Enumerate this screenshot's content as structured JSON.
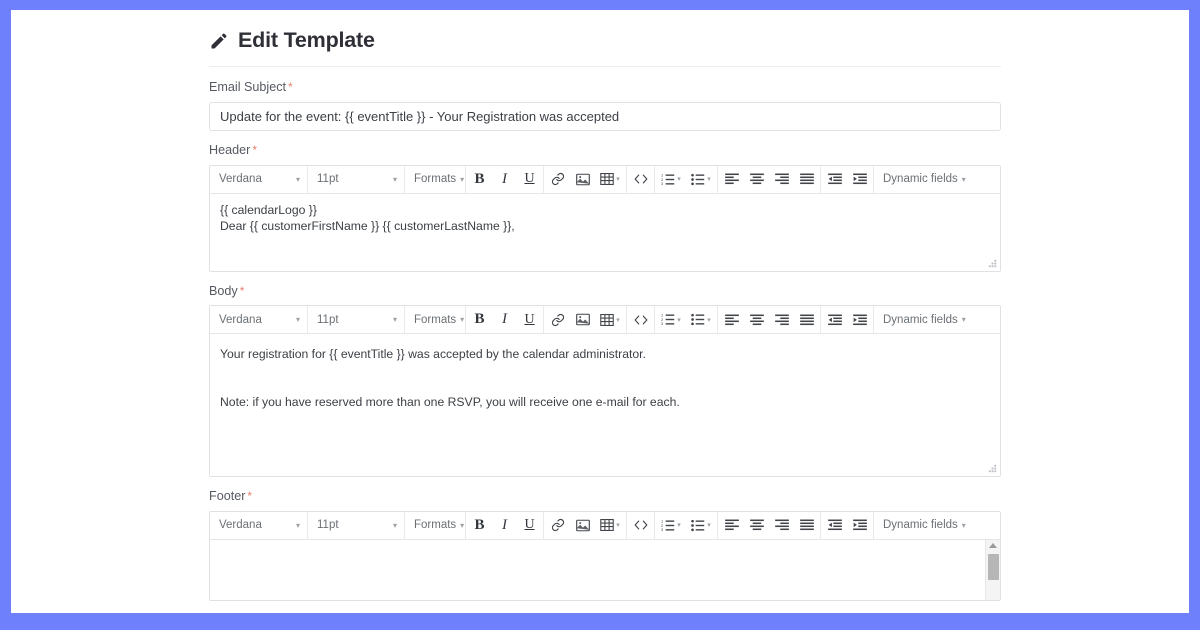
{
  "theme": {
    "frame_color": "#6e80fb",
    "page_background": "#ffffff",
    "required_marker_color": "#e8806f",
    "title_color": "#2f3037",
    "label_color": "#555a61",
    "border_color": "#dfe1e5"
  },
  "header": {
    "title": "Edit Template",
    "icon": "pencil-icon"
  },
  "fields": {
    "subject": {
      "label": "Email Subject",
      "required_marker": "*",
      "value": "Update for the event: {{ eventTitle }} - Your Registration was accepted",
      "placeholder": ""
    },
    "header_section": {
      "label": "Header",
      "required_marker": "*",
      "lines": [
        "{{ calendarLogo }}",
        "Dear {{ customerFirstName }} {{ customerLastName }},"
      ]
    },
    "body_section": {
      "label": "Body",
      "required_marker": "*",
      "lines": [
        "Your registration for {{ eventTitle }} was accepted by the calendar administrator.",
        "Note: if you have reserved more than one RSVP, you will receive one e-mail for each."
      ]
    },
    "footer_section": {
      "label": "Footer",
      "required_marker": "*",
      "lines": []
    }
  },
  "toolbar": {
    "font_family": "Verdana",
    "font_size": "11pt",
    "formats_label": "Formats",
    "dynamic_fields_label": "Dynamic fields",
    "caret": "▾",
    "buttons": [
      {
        "name": "bold-icon",
        "label": "B"
      },
      {
        "name": "italic-icon",
        "label": "I"
      },
      {
        "name": "underline-icon",
        "label": "U"
      },
      {
        "name": "link-icon",
        "label": "Insert link"
      },
      {
        "name": "image-icon",
        "label": "Insert image"
      },
      {
        "name": "table-icon",
        "label": "Table"
      },
      {
        "name": "source-code-icon",
        "label": "Source code"
      },
      {
        "name": "numbered-list-icon",
        "label": "Numbered list"
      },
      {
        "name": "bullet-list-icon",
        "label": "Bullet list"
      },
      {
        "name": "align-left-icon",
        "label": "Align left"
      },
      {
        "name": "align-center-icon",
        "label": "Align center"
      },
      {
        "name": "align-right-icon",
        "label": "Align right"
      },
      {
        "name": "align-justify-icon",
        "label": "Justify"
      },
      {
        "name": "outdent-icon",
        "label": "Decrease indent"
      },
      {
        "name": "indent-icon",
        "label": "Increase indent"
      }
    ]
  }
}
